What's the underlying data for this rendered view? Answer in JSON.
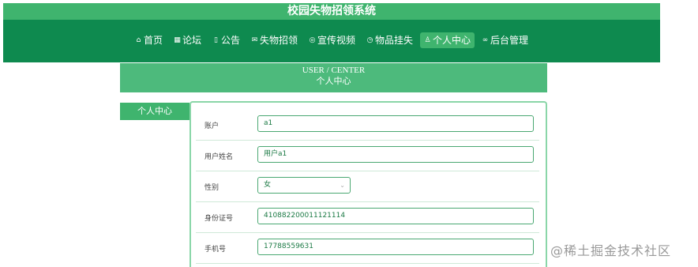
{
  "site_title": "校园失物招领系统",
  "nav": [
    {
      "icon": "home-icon",
      "glyph": "⌂",
      "label": "首页",
      "active": false
    },
    {
      "icon": "forum-icon",
      "glyph": "▦",
      "label": "论坛",
      "active": false
    },
    {
      "icon": "notice-icon",
      "glyph": "▯",
      "label": "公告",
      "active": false
    },
    {
      "icon": "mail-icon",
      "glyph": "✉",
      "label": "失物招领",
      "active": false
    },
    {
      "icon": "video-icon",
      "glyph": "◎",
      "label": "宣传视频",
      "active": false
    },
    {
      "icon": "clock-icon",
      "glyph": "◷",
      "label": "物品挂失",
      "active": false
    },
    {
      "icon": "user-icon",
      "glyph": "♙",
      "label": "个人中心",
      "active": true
    },
    {
      "icon": "link-icon",
      "glyph": "∞",
      "label": "后台管理",
      "active": false
    }
  ],
  "banner": {
    "en": "USER / CENTER",
    "cn": "个人中心"
  },
  "side_tab": "个人中心",
  "form": {
    "account_label": "账户",
    "account_value": "a1",
    "name_label": "用户姓名",
    "name_value": "用户a1",
    "gender_label": "性别",
    "gender_value": "女",
    "idcard_label": "身份证号",
    "idcard_value": "410882200011121114",
    "phone_label": "手机号",
    "phone_value": "17788559631"
  },
  "watermark": "@稀土掘金技术社区"
}
